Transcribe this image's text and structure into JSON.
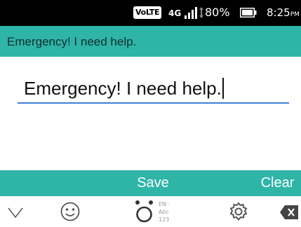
{
  "status_bar": {
    "volte": "VoLTE",
    "network_type": "4G",
    "signal_icon": "signal-bars-icon",
    "battery_percent": "80%",
    "battery_icon": "battery-icon",
    "time": "8:25",
    "ampm": "PM"
  },
  "title_bar": {
    "title": "Emergency! I need help."
  },
  "message_field": {
    "value": "Emergency! I need help."
  },
  "action_bar": {
    "save_label": "Save",
    "clear_label": "Clear"
  },
  "keyboard_toolbar": {
    "icons": [
      "chevron-down-icon",
      "emoji-icon",
      "input-method-icon",
      "settings-gear-icon",
      "backspace-icon"
    ],
    "ime_labels": [
      "EN··",
      "Abc",
      "123"
    ]
  }
}
